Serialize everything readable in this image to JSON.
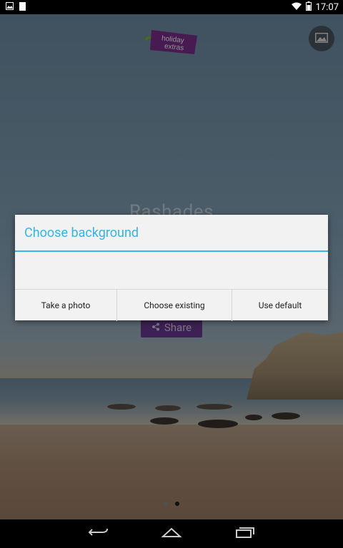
{
  "status_bar": {
    "time": "17:07",
    "left_icons": [
      "image-notification-icon",
      "sim-card-icon"
    ],
    "right_icons": [
      "wifi-icon",
      "battery-icon"
    ]
  },
  "app": {
    "logo_text_line1": "holiday",
    "logo_text_line2": "extras",
    "place_title": "Rashades",
    "share_label": "Share",
    "gallery_icon": "gallery-icon",
    "share_icon": "share-icon",
    "page_indicator": {
      "count": 2,
      "active_index": 1
    }
  },
  "dialog": {
    "title": "Choose background",
    "buttons": {
      "take_photo": "Take a photo",
      "choose_existing": "Choose existing",
      "use_default": "Use default"
    }
  },
  "nav_bar": {
    "icons": [
      "back-icon",
      "home-icon",
      "recents-icon"
    ]
  },
  "colors": {
    "dialog_accent": "#33b5e5",
    "share_button": "#6a3a93",
    "logo_bg": "#7b2d8e",
    "logo_green": "#7ab929"
  }
}
